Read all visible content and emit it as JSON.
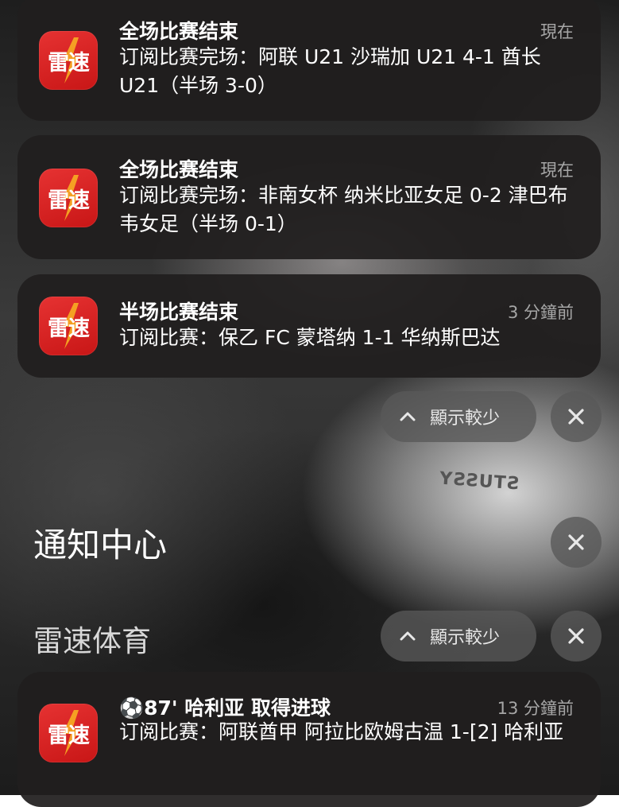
{
  "notifications": [
    {
      "app_icon_text": "雷速",
      "title": "全场比赛结束",
      "time": "現在",
      "body": "订阅比赛完场：阿联 U21 沙瑞加 U21 4-1 酋长 U21（半场 3-0）"
    },
    {
      "app_icon_text": "雷速",
      "title": "全场比赛结束",
      "time": "現在",
      "body": "订阅比赛完场：非南女杯 纳米比亚女足 0-2 津巴布韦女足（半场 0-1）"
    },
    {
      "app_icon_text": "雷速",
      "title": "半场比赛结束",
      "time": "3 分鐘前",
      "body": "订阅比赛：保乙 FC 蒙塔纳 1-1 华纳斯巴达"
    },
    {
      "app_icon_text": "雷速",
      "title": "⚽87' 哈利亚 取得进球",
      "time": "13 分鐘前",
      "body": "订阅比赛：阿联酋甲 阿拉比欧姆古温 1-[2] 哈利亚"
    }
  ],
  "group_top": {
    "show_less_label": "顯示較少",
    "chevron_icon": "chevron-up-icon",
    "close_icon": "close-icon"
  },
  "notification_center": {
    "title": "通知中心",
    "close_icon": "close-icon"
  },
  "app_group": {
    "name": "雷速体育",
    "show_less_label": "顯示較少",
    "chevron_icon": "chevron-up-icon",
    "close_icon": "close-icon"
  },
  "wallpaper": {
    "shirt_text": "STUSSY"
  },
  "colors": {
    "icon_red": "#d61e1e",
    "card_bg": "#201e1e",
    "secondary_text": "#a6a6a6"
  }
}
